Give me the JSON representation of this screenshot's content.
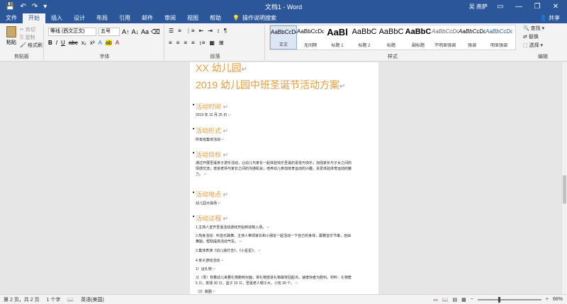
{
  "titlebar": {
    "doc_title": "文档1 - Word",
    "user": "吴 燕萨",
    "qat": [
      "save-icon",
      "undo-icon",
      "redo-icon",
      "customize-icon"
    ]
  },
  "tabs": [
    "文件",
    "开始",
    "插入",
    "设计",
    "布局",
    "引用",
    "邮件",
    "审阅",
    "视图",
    "帮助"
  ],
  "active_tab": "开始",
  "tellme": "操作说明搜索",
  "share": "共享",
  "ribbon": {
    "clipboard": {
      "paste": "粘贴",
      "cut": "剪切",
      "copy": "复制",
      "format_painter": "格式刷",
      "label": "剪贴板"
    },
    "font": {
      "name": "等线 (西文正文)",
      "size": "五号",
      "label": "字体"
    },
    "paragraph": {
      "label": "段落"
    },
    "styles": {
      "label": "样式",
      "items": [
        {
          "sample": "AaBbCcDd",
          "name": "正文"
        },
        {
          "sample": "AaBbCcDd",
          "name": "无间隔"
        },
        {
          "sample": "AaBl",
          "name": "标题 1"
        },
        {
          "sample": "AaBbC",
          "name": "标题 2"
        },
        {
          "sample": "AaBbC",
          "name": "标题"
        },
        {
          "sample": "AaBbC",
          "name": "副标题"
        },
        {
          "sample": "AaBbCcDd",
          "name": "不明显强调"
        },
        {
          "sample": "AaBbCcDd",
          "name": "强调"
        },
        {
          "sample": "AaBbCcDd",
          "name": "明显强调"
        }
      ]
    },
    "editing": {
      "find": "查找",
      "replace": "替换",
      "select": "选择",
      "label": "编辑"
    }
  },
  "document": {
    "title1": "XX 幼儿园",
    "title2": "2019 幼儿园中班圣诞节活动方案",
    "sections": [
      {
        "heading": "活动时间",
        "body": "2019 年 12 月 25 日"
      },
      {
        "heading": "活动形式",
        "body": "所有班集体活动"
      },
      {
        "heading": "活动目标",
        "body": "通过开展圣诞亲子游乐活动，让幼儿与家长一起体验快乐圣诞的喜悦与快乐；加强家长与子女之间的情感交流；增进老师与家长之间的沟通机会；培养幼儿参加体育运动的兴趣，关爱体验体育运动的魅力。"
      },
      {
        "heading": "活动地点",
        "body": "幼儿园大操场"
      },
      {
        "heading": "活动过程",
        "items": [
          "1.主持人宣开圣诞活动游戏开始到动物入场。",
          "2.热身活动：听音乐跳舞，主持人带领家长和小朋友一起活动一下自己的身体，跟着音乐节奏，自由舞蹈，帮助提高活动气氛。",
          "3.集体表演《幼儿操打击》，《小星星》。",
          "4.亲子游戏活动",
          "1）运礼物",
          "父（母）背着幼儿来着礼物跑到对面，将礼物放进礼物袋背回起点，速度快者为胜利。材料：礼物筐 5 只，皮球 30 只，篮子 10 只，圣诞老人帽子大，小包 30 个。",
          "（2）跳圈"
        ]
      }
    ]
  },
  "status": {
    "page": "第 2 页，共 2 页",
    "words": "1 个字",
    "lang": "英语(美国)",
    "zoom": "66%",
    "zoom_fraction": 0.66
  }
}
